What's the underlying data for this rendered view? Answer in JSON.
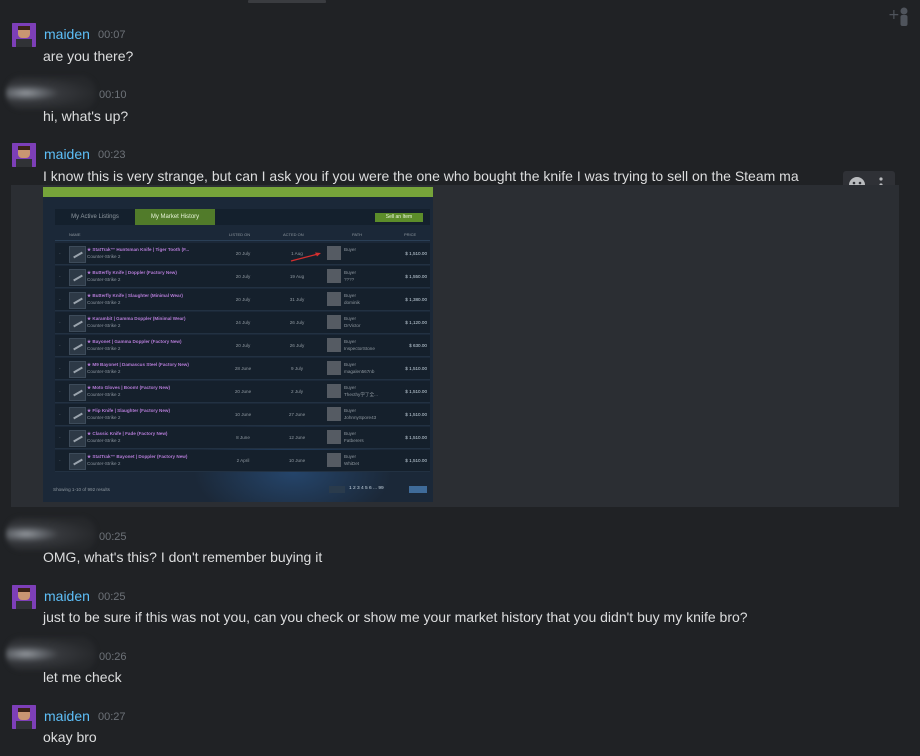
{
  "messages": [
    {
      "author": "maiden",
      "time": "00:07",
      "text": "are you there?"
    },
    {
      "author": "",
      "time": "00:10",
      "text": "hi, what's up?"
    },
    {
      "author": "maiden",
      "time": "00:23",
      "text": "I know this is very strange, but can I ask you if you were the one who bought the knife I was trying to sell on the Steam ma"
    },
    {
      "author": "",
      "time": "00:25",
      "text": "OMG, what's this? I don't remember buying it"
    },
    {
      "author": "maiden",
      "time": "00:25",
      "text": "just to be sure if this was not you, can you check or show me your market history that you didn't buy my knife bro?"
    },
    {
      "author": "",
      "time": "00:26",
      "text": "let me check"
    },
    {
      "author": "maiden",
      "time": "00:27",
      "text": "okay bro"
    }
  ],
  "icons": {
    "add_user": "add-friend-icon",
    "emoji": "emoji-icon",
    "more": "more-options-icon"
  },
  "colors": {
    "background": "#202225",
    "name": "#5dbff8",
    "time": "#6d7278",
    "text": "#dcddde",
    "item_name": "#b47bd6"
  },
  "embed": {
    "tab_active_listings": "My Active Listings",
    "tab_market_history": "My Market History",
    "sell_button": "Sell an Item",
    "columns": [
      "NAME",
      "LISTED ON",
      "ACTED ON",
      "PATH",
      "PRICE"
    ],
    "rows": [
      {
        "name": "★ StatTrak™ Huntsman Knife | Tiger Tooth (F...",
        "game": "Counter-Strike 2",
        "listed": "20 July",
        "acted": "1 Aug",
        "buyer": "Buyer",
        "buyer_name": "",
        "price": "$ 1,510.00"
      },
      {
        "name": "★ Butterfly Knife | Doppler (Factory New)",
        "game": "Counter-Strike 2",
        "listed": "20 July",
        "acted": "19 Aug",
        "buyer": "Buyer",
        "buyer_name": "????",
        "price": "$ 1,550.00"
      },
      {
        "name": "★ Butterfly Knife | Slaughter (Minimal Wear)",
        "game": "Counter-Strike 2",
        "listed": "20 July",
        "acted": "31 July",
        "buyer": "Buyer",
        "buyer_name": "dominik",
        "price": "$ 1,380.00"
      },
      {
        "name": "★ Karambit | Gamma Doppler (Minimal Wear)",
        "game": "Counter-Strike 2",
        "listed": "24 July",
        "acted": "26 July",
        "buyer": "Buyer",
        "buyer_name": "DrVictor",
        "price": "$ 1,120.00"
      },
      {
        "name": "★ Bayonet | Gamma Doppler (Factory New)",
        "game": "Counter-Strike 2",
        "listed": "20 July",
        "acted": "26 July",
        "buyer": "Buyer",
        "buyer_name": "InspectorStone",
        "price": "$ 630.00"
      },
      {
        "name": "★ M9 Bayonet | Damascus Steel (Factory New)",
        "game": "Counter-Strike 2",
        "listed": "28 June",
        "acted": "9 July",
        "buyer": "Buyer",
        "buyer_name": "magalen567nb",
        "price": "$ 1,510.00"
      },
      {
        "name": "★ Moto Gloves | Boom! (Factory New)",
        "game": "Counter-Strike 2",
        "listed": "20 June",
        "acted": "2 July",
        "buyer": "Buyer",
        "buyer_name": "Thecthy学了全...",
        "price": "$ 1,510.00"
      },
      {
        "name": "★ Flip Knife | Slaughter (Factory New)",
        "game": "Counter-Strike 2",
        "listed": "10 June",
        "acted": "27 June",
        "buyer": "Buyer",
        "buyer_name": "JohnnySpore43",
        "price": "$ 1,510.00"
      },
      {
        "name": "★ Classic Knife | Fade (Factory New)",
        "game": "Counter-Strike 2",
        "listed": "8 June",
        "acted": "12 June",
        "buyer": "Buyer",
        "buyer_name": "Fatberers",
        "price": "$ 1,510.00"
      },
      {
        "name": "★ StatTrak™ Bayonet | Doppler (Factory New)",
        "game": "Counter-Strike 2",
        "listed": "2 April",
        "acted": "10 June",
        "buyer": "Buyer",
        "buyer_name": "WhiDet",
        "price": "$ 1,510.00"
      }
    ],
    "showing": "Showing 1-10 of 992 results",
    "pages": "1 2 3 4 5 6 ... 99"
  }
}
